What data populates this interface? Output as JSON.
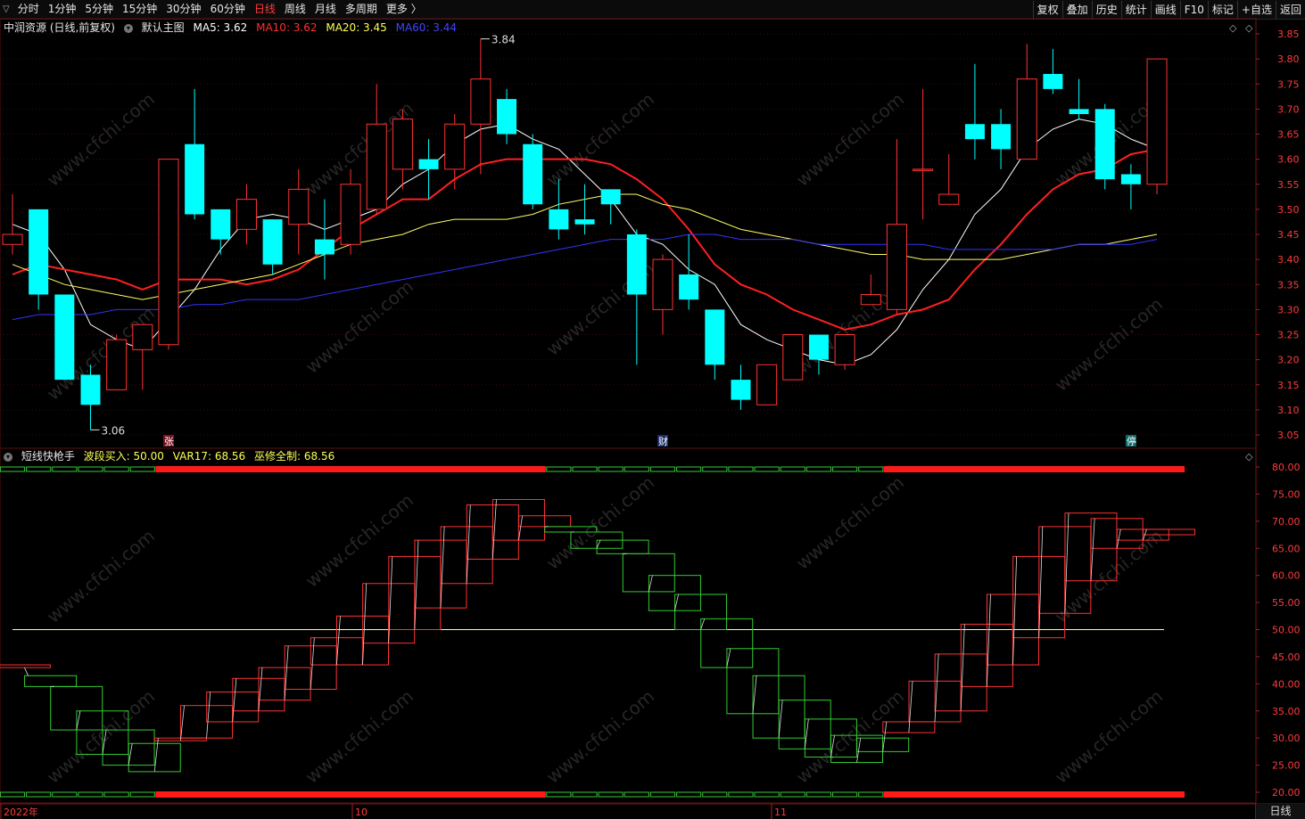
{
  "toolbar": {
    "periods": [
      "分时",
      "1分钟",
      "5分钟",
      "15分钟",
      "30分钟",
      "60分钟",
      "日线",
      "周线",
      "月线",
      "多周期",
      "更多 〉"
    ],
    "active_period": "日线",
    "buttons": [
      "复权",
      "叠加",
      "历史",
      "统计",
      "画线",
      "F10",
      "标记",
      "+自选",
      "返回"
    ]
  },
  "main_info": {
    "stock": "中润资源 (日线,前复权)",
    "template": "默认主图",
    "ma5": "MA5: 3.62",
    "ma10": "MA10: 3.62",
    "ma20": "MA20: 3.45",
    "ma60": "MA60: 3.44"
  },
  "sub_info": {
    "name": "短线快枪手",
    "buy": "波段买入: 50.00",
    "var17": "VAR17: 68.56",
    "wu": "巫修全制: 68.56"
  },
  "markers": {
    "zhang": "张",
    "cai": "财",
    "ting": "停"
  },
  "annotations": {
    "high": "3.84",
    "low": "3.06"
  },
  "x_labels": [
    "2022年",
    "10",
    "11"
  ],
  "bottom_tab": "日线",
  "watermark": "www.cfchi.com",
  "colors": {
    "up": "#ff3232",
    "down": "#00ffff",
    "ma5": "#ffffff",
    "ma10": "#ff2020",
    "ma20": "#ffff66",
    "ma60": "#3333ff",
    "green": "#33cc33",
    "red_bar": "#ff1a1a"
  },
  "chart_data": [
    {
      "type": "candlestick",
      "title": "中润资源 (日线,前复权)",
      "ylim": [
        3.02,
        3.88
      ],
      "yticks": [
        "3.85",
        "3.80",
        "3.75",
        "3.70",
        "3.65",
        "3.60",
        "3.55",
        "3.50",
        "3.45",
        "3.40",
        "3.35",
        "3.30",
        "3.25",
        "3.20",
        "3.15",
        "3.10",
        "3.05"
      ],
      "candles": [
        {
          "o": 3.43,
          "c": 3.45,
          "h": 3.53,
          "l": 3.41
        },
        {
          "o": 3.5,
          "c": 3.33,
          "h": 3.5,
          "l": 3.3
        },
        {
          "o": 3.33,
          "c": 3.16,
          "h": 3.33,
          "l": 3.16
        },
        {
          "o": 3.17,
          "c": 3.11,
          "h": 3.19,
          "l": 3.06
        },
        {
          "o": 3.14,
          "c": 3.24,
          "h": 3.25,
          "l": 3.14
        },
        {
          "o": 3.22,
          "c": 3.27,
          "h": 3.27,
          "l": 3.14
        },
        {
          "o": 3.23,
          "c": 3.6,
          "h": 3.6,
          "l": 3.22
        },
        {
          "o": 3.63,
          "c": 3.49,
          "h": 3.74,
          "l": 3.48
        },
        {
          "o": 3.5,
          "c": 3.44,
          "h": 3.5,
          "l": 3.41
        },
        {
          "o": 3.46,
          "c": 3.52,
          "h": 3.55,
          "l": 3.43
        },
        {
          "o": 3.48,
          "c": 3.39,
          "h": 3.48,
          "l": 3.37
        },
        {
          "o": 3.47,
          "c": 3.54,
          "h": 3.58,
          "l": 3.41
        },
        {
          "o": 3.44,
          "c": 3.41,
          "h": 3.52,
          "l": 3.36
        },
        {
          "o": 3.43,
          "c": 3.55,
          "h": 3.58,
          "l": 3.41
        },
        {
          "o": 3.5,
          "c": 3.67,
          "h": 3.75,
          "l": 3.49
        },
        {
          "o": 3.58,
          "c": 3.68,
          "h": 3.7,
          "l": 3.54
        },
        {
          "o": 3.6,
          "c": 3.58,
          "h": 3.64,
          "l": 3.52
        },
        {
          "o": 3.58,
          "c": 3.67,
          "h": 3.69,
          "l": 3.54
        },
        {
          "o": 3.67,
          "c": 3.76,
          "h": 3.84,
          "l": 3.57
        },
        {
          "o": 3.72,
          "c": 3.65,
          "h": 3.74,
          "l": 3.63
        },
        {
          "o": 3.63,
          "c": 3.51,
          "h": 3.65,
          "l": 3.5
        },
        {
          "o": 3.5,
          "c": 3.46,
          "h": 3.56,
          "l": 3.44
        },
        {
          "o": 3.48,
          "c": 3.47,
          "h": 3.55,
          "l": 3.45
        },
        {
          "o": 3.54,
          "c": 3.51,
          "h": 3.54,
          "l": 3.47
        },
        {
          "o": 3.45,
          "c": 3.33,
          "h": 3.46,
          "l": 3.19
        },
        {
          "o": 3.3,
          "c": 3.4,
          "h": 3.41,
          "l": 3.25
        },
        {
          "o": 3.37,
          "c": 3.32,
          "h": 3.45,
          "l": 3.3
        },
        {
          "o": 3.3,
          "c": 3.19,
          "h": 3.3,
          "l": 3.16
        },
        {
          "o": 3.16,
          "c": 3.12,
          "h": 3.19,
          "l": 3.1
        },
        {
          "o": 3.11,
          "c": 3.19,
          "h": 3.19,
          "l": 3.11
        },
        {
          "o": 3.16,
          "c": 3.25,
          "h": 3.25,
          "l": 3.16
        },
        {
          "o": 3.25,
          "c": 3.2,
          "h": 3.25,
          "l": 3.17
        },
        {
          "o": 3.19,
          "c": 3.25,
          "h": 3.25,
          "l": 3.18
        },
        {
          "o": 3.31,
          "c": 3.33,
          "h": 3.37,
          "l": 3.31
        },
        {
          "o": 3.3,
          "c": 3.47,
          "h": 3.64,
          "l": 3.29
        },
        {
          "o": 3.58,
          "c": 3.58,
          "h": 3.74,
          "l": 3.48
        },
        {
          "o": 3.51,
          "c": 3.53,
          "h": 3.61,
          "l": 3.51
        },
        {
          "o": 3.67,
          "c": 3.64,
          "h": 3.79,
          "l": 3.6
        },
        {
          "o": 3.67,
          "c": 3.62,
          "h": 3.7,
          "l": 3.58
        },
        {
          "o": 3.6,
          "c": 3.76,
          "h": 3.83,
          "l": 3.6
        },
        {
          "o": 3.77,
          "c": 3.74,
          "h": 3.82,
          "l": 3.73
        },
        {
          "o": 3.7,
          "c": 3.69,
          "h": 3.76,
          "l": 3.68
        },
        {
          "o": 3.7,
          "c": 3.56,
          "h": 3.71,
          "l": 3.54
        },
        {
          "o": 3.57,
          "c": 3.55,
          "h": 3.59,
          "l": 3.5
        },
        {
          "o": 3.55,
          "c": 3.8,
          "h": 3.8,
          "l": 3.53
        }
      ],
      "series": [
        {
          "name": "MA5",
          "values": [
            3.47,
            3.45,
            3.38,
            3.27,
            3.24,
            3.22,
            3.28,
            3.34,
            3.42,
            3.48,
            3.49,
            3.48,
            3.46,
            3.48,
            3.5,
            3.55,
            3.58,
            3.63,
            3.66,
            3.67,
            3.64,
            3.62,
            3.57,
            3.52,
            3.45,
            3.43,
            3.38,
            3.35,
            3.27,
            3.24,
            3.22,
            3.2,
            3.19,
            3.21,
            3.26,
            3.34,
            3.4,
            3.49,
            3.54,
            3.62,
            3.66,
            3.68,
            3.67,
            3.64,
            3.62
          ]
        },
        {
          "name": "MA10",
          "values": [
            3.37,
            3.39,
            3.38,
            3.37,
            3.36,
            3.34,
            3.36,
            3.36,
            3.36,
            3.35,
            3.36,
            3.38,
            3.42,
            3.46,
            3.49,
            3.52,
            3.52,
            3.56,
            3.59,
            3.6,
            3.6,
            3.6,
            3.6,
            3.59,
            3.56,
            3.52,
            3.46,
            3.39,
            3.35,
            3.33,
            3.3,
            3.28,
            3.26,
            3.27,
            3.29,
            3.3,
            3.32,
            3.38,
            3.43,
            3.49,
            3.54,
            3.57,
            3.58,
            3.61,
            3.62
          ]
        },
        {
          "name": "MA20",
          "values": [
            3.39,
            3.37,
            3.35,
            3.34,
            3.33,
            3.32,
            3.33,
            3.34,
            3.35,
            3.36,
            3.37,
            3.39,
            3.41,
            3.43,
            3.44,
            3.45,
            3.47,
            3.48,
            3.48,
            3.48,
            3.49,
            3.51,
            3.52,
            3.53,
            3.53,
            3.51,
            3.5,
            3.48,
            3.46,
            3.45,
            3.44,
            3.43,
            3.42,
            3.41,
            3.41,
            3.4,
            3.4,
            3.4,
            3.4,
            3.41,
            3.42,
            3.43,
            3.43,
            3.44,
            3.45
          ]
        },
        {
          "name": "MA60",
          "values": [
            3.28,
            3.29,
            3.29,
            3.29,
            3.3,
            3.3,
            3.3,
            3.31,
            3.31,
            3.32,
            3.32,
            3.32,
            3.33,
            3.34,
            3.35,
            3.36,
            3.37,
            3.38,
            3.39,
            3.4,
            3.41,
            3.42,
            3.43,
            3.44,
            3.44,
            3.44,
            3.45,
            3.45,
            3.44,
            3.44,
            3.44,
            3.43,
            3.43,
            3.43,
            3.43,
            3.43,
            3.42,
            3.42,
            3.42,
            3.42,
            3.42,
            3.43,
            3.43,
            3.43,
            3.44
          ]
        }
      ]
    },
    {
      "type": "bar",
      "title": "短线快枪手",
      "ylim": [
        18,
        82
      ],
      "yticks": [
        "80.00",
        "75.00",
        "70.00",
        "65.00",
        "60.00",
        "55.00",
        "50.00",
        "45.00",
        "40.00",
        "35.00",
        "30.00",
        "25.00",
        "20.00"
      ],
      "reference_line": 50,
      "boxes": [
        {
          "top": 43.5,
          "bottom": 43.0,
          "color": "red"
        },
        {
          "top": 41.5,
          "bottom": 39.5,
          "color": "green"
        },
        {
          "top": 39.5,
          "bottom": 31.5,
          "color": "green"
        },
        {
          "top": 35.0,
          "bottom": 27.0,
          "color": "green"
        },
        {
          "top": 31.5,
          "bottom": 25.0,
          "color": "green"
        },
        {
          "top": 29.0,
          "bottom": 23.8,
          "color": "green"
        },
        {
          "top": 30.0,
          "bottom": 29.5,
          "color": "red"
        },
        {
          "top": 36.0,
          "bottom": 30.0,
          "color": "red"
        },
        {
          "top": 38.5,
          "bottom": 33.0,
          "color": "red"
        },
        {
          "top": 41.0,
          "bottom": 35.0,
          "color": "red"
        },
        {
          "top": 43.0,
          "bottom": 37.0,
          "color": "red"
        },
        {
          "top": 47.0,
          "bottom": 39.0,
          "color": "red"
        },
        {
          "top": 48.5,
          "bottom": 43.5,
          "color": "red"
        },
        {
          "top": 52.5,
          "bottom": 43.5,
          "color": "red"
        },
        {
          "top": 58.5,
          "bottom": 47.5,
          "color": "red"
        },
        {
          "top": 63.5,
          "bottom": 50.0,
          "color": "red"
        },
        {
          "top": 66.5,
          "bottom": 54.0,
          "color": "red"
        },
        {
          "top": 69.0,
          "bottom": 58.5,
          "color": "red"
        },
        {
          "top": 73.0,
          "bottom": 63.0,
          "color": "red"
        },
        {
          "top": 74.0,
          "bottom": 66.5,
          "color": "red"
        },
        {
          "top": 71.0,
          "bottom": 69.0,
          "color": "red"
        },
        {
          "top": 69.0,
          "bottom": 68.0,
          "color": "green"
        },
        {
          "top": 68.0,
          "bottom": 65.0,
          "color": "green"
        },
        {
          "top": 66.5,
          "bottom": 64.0,
          "color": "green"
        },
        {
          "top": 64.0,
          "bottom": 57.0,
          "color": "green"
        },
        {
          "top": 60.0,
          "bottom": 53.5,
          "color": "green"
        },
        {
          "top": 56.5,
          "bottom": 50.0,
          "color": "green"
        },
        {
          "top": 52.0,
          "bottom": 43.0,
          "color": "green"
        },
        {
          "top": 46.5,
          "bottom": 34.5,
          "color": "green"
        },
        {
          "top": 41.5,
          "bottom": 30.0,
          "color": "green"
        },
        {
          "top": 37.0,
          "bottom": 28.0,
          "color": "green"
        },
        {
          "top": 33.5,
          "bottom": 26.5,
          "color": "green"
        },
        {
          "top": 30.5,
          "bottom": 25.5,
          "color": "green"
        },
        {
          "top": 30.0,
          "bottom": 27.5,
          "color": "green"
        },
        {
          "top": 33.0,
          "bottom": 31.0,
          "color": "red"
        },
        {
          "top": 40.5,
          "bottom": 33.0,
          "color": "red"
        },
        {
          "top": 45.5,
          "bottom": 35.0,
          "color": "red"
        },
        {
          "top": 51.0,
          "bottom": 39.5,
          "color": "red"
        },
        {
          "top": 56.5,
          "bottom": 43.5,
          "color": "red"
        },
        {
          "top": 63.5,
          "bottom": 48.5,
          "color": "red"
        },
        {
          "top": 69.0,
          "bottom": 53.0,
          "color": "red"
        },
        {
          "top": 71.5,
          "bottom": 59.0,
          "color": "red"
        },
        {
          "top": 70.5,
          "bottom": 65.0,
          "color": "red"
        },
        {
          "top": 68.5,
          "bottom": 66.5,
          "color": "red"
        },
        {
          "top": 68.5,
          "bottom": 67.5,
          "color": "red"
        }
      ],
      "signal_segments": [
        {
          "from": 0,
          "to": 6,
          "color": "green"
        },
        {
          "from": 6,
          "to": 21,
          "color": "red"
        },
        {
          "from": 21,
          "to": 34,
          "color": "green"
        },
        {
          "from": 34,
          "to": 45,
          "color": "red"
        }
      ]
    }
  ]
}
